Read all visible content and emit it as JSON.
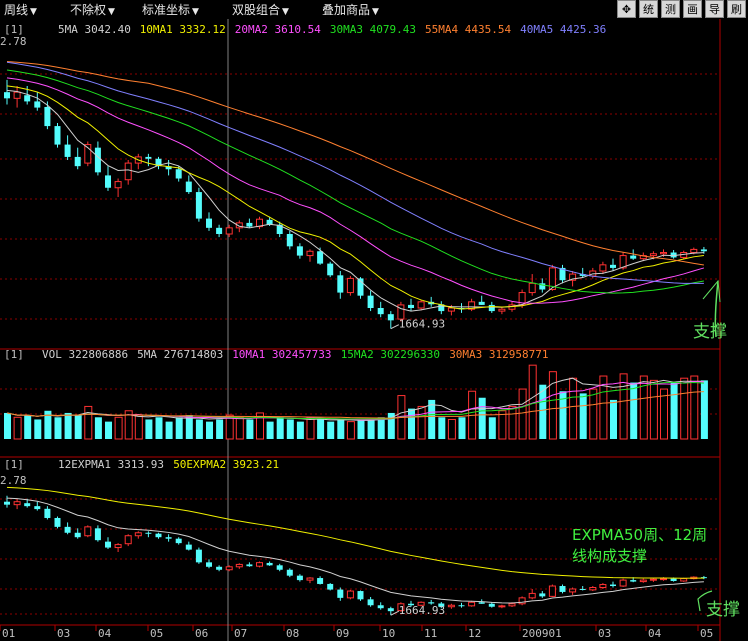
{
  "toolbar": {
    "menus": [
      {
        "label": "周线"
      },
      {
        "label": "不除权"
      },
      {
        "label": "标准坐标"
      },
      {
        "label": "双股组合"
      },
      {
        "label": "叠加商品"
      }
    ],
    "buttons": [
      {
        "icon": "move-crosshair-icon",
        "label": "✥"
      },
      {
        "icon": "",
        "label": "统"
      },
      {
        "icon": "",
        "label": "测"
      },
      {
        "icon": "",
        "label": "画"
      },
      {
        "icon": "",
        "label": "导"
      },
      {
        "icon": "",
        "label": "刷"
      }
    ]
  },
  "chart_data": [
    {
      "panel": "price",
      "type": "candlestick",
      "header_prefix": "[1]",
      "y_top_label": "2.78",
      "indicators": [
        {
          "name": "5MA",
          "value": "3042.40",
          "color": "#d0d0d0"
        },
        {
          "name": "10MA1",
          "value": "3332.12",
          "color": "#f0f000"
        },
        {
          "name": "20MA2",
          "value": "3610.54",
          "color": "#ff50ff"
        },
        {
          "name": "30MA3",
          "value": "4079.43",
          "color": "#20e020"
        },
        {
          "name": "55MA4",
          "value": "4435.54",
          "color": "#ff8030"
        },
        {
          "name": "40MA5",
          "value": "4425.36",
          "color": "#8080ff"
        }
      ],
      "low_label": "1664.93",
      "annotation": "支撑",
      "ylim": [
        1400,
        6200
      ],
      "ohlc": [
        [
          5500,
          5700,
          5300,
          5400
        ],
        [
          5400,
          5600,
          5250,
          5500
        ],
        [
          5450,
          5600,
          5300,
          5350
        ],
        [
          5350,
          5500,
          5200,
          5250
        ],
        [
          5260,
          5350,
          4900,
          4950
        ],
        [
          4950,
          5000,
          4600,
          4650
        ],
        [
          4650,
          4800,
          4400,
          4450
        ],
        [
          4450,
          4600,
          4250,
          4300
        ],
        [
          4350,
          4700,
          4300,
          4650
        ],
        [
          4600,
          4700,
          4150,
          4200
        ],
        [
          4150,
          4300,
          3900,
          3950
        ],
        [
          3950,
          4100,
          3800,
          4050
        ],
        [
          4080,
          4400,
          4000,
          4350
        ],
        [
          4350,
          4500,
          4250,
          4450
        ],
        [
          4450,
          4500,
          4300,
          4420
        ],
        [
          4420,
          4450,
          4250,
          4300
        ],
        [
          4300,
          4400,
          4150,
          4250
        ],
        [
          4250,
          4300,
          4050,
          4100
        ],
        [
          4050,
          4150,
          3850,
          3880
        ],
        [
          3880,
          3950,
          3400,
          3450
        ],
        [
          3450,
          3550,
          3250,
          3300
        ],
        [
          3300,
          3350,
          3150,
          3200
        ],
        [
          3200,
          3350,
          3150,
          3300
        ],
        [
          3300,
          3420,
          3230,
          3380
        ],
        [
          3380,
          3450,
          3300,
          3320
        ],
        [
          3320,
          3480,
          3280,
          3440
        ],
        [
          3430,
          3480,
          3330,
          3350
        ],
        [
          3350,
          3400,
          3150,
          3200
        ],
        [
          3200,
          3250,
          2950,
          3000
        ],
        [
          3000,
          3050,
          2800,
          2850
        ],
        [
          2850,
          2950,
          2750,
          2920
        ],
        [
          2920,
          2980,
          2700,
          2720
        ],
        [
          2720,
          2750,
          2500,
          2530
        ],
        [
          2530,
          2600,
          2150,
          2250
        ],
        [
          2250,
          2520,
          2200,
          2480
        ],
        [
          2480,
          2500,
          2150,
          2200
        ],
        [
          2200,
          2280,
          1950,
          2000
        ],
        [
          2000,
          2100,
          1850,
          1900
        ],
        [
          1900,
          1950,
          1664.93,
          1800
        ],
        [
          1820,
          2100,
          1780,
          2050
        ],
        [
          2050,
          2150,
          1950,
          2000
        ],
        [
          2000,
          2130,
          1960,
          2100
        ],
        [
          2100,
          2180,
          2020,
          2060
        ],
        [
          2060,
          2110,
          1900,
          1950
        ],
        [
          1950,
          2050,
          1880,
          2000
        ],
        [
          2000,
          2080,
          1920,
          1980
        ],
        [
          1980,
          2150,
          1950,
          2100
        ],
        [
          2100,
          2200,
          2050,
          2050
        ],
        [
          2050,
          2100,
          1920,
          1950
        ],
        [
          1950,
          2020,
          1900,
          1980
        ],
        [
          1980,
          2100,
          1940,
          2050
        ],
        [
          2050,
          2300,
          2000,
          2250
        ],
        [
          2250,
          2550,
          2200,
          2400
        ],
        [
          2400,
          2480,
          2250,
          2300
        ],
        [
          2300,
          2700,
          2280,
          2650
        ],
        [
          2650,
          2700,
          2400,
          2450
        ],
        [
          2450,
          2600,
          2350,
          2550
        ],
        [
          2550,
          2650,
          2500,
          2520
        ],
        [
          2520,
          2650,
          2480,
          2600
        ],
        [
          2600,
          2750,
          2550,
          2700
        ],
        [
          2700,
          2800,
          2600,
          2650
        ],
        [
          2650,
          2900,
          2620,
          2850
        ],
        [
          2850,
          2950,
          2780,
          2800
        ],
        [
          2800,
          2900,
          2760,
          2850
        ],
        [
          2850,
          2920,
          2790,
          2880
        ],
        [
          2880,
          2950,
          2830,
          2900
        ],
        [
          2900,
          2940,
          2800,
          2820
        ],
        [
          2820,
          2930,
          2790,
          2900
        ],
        [
          2900,
          2980,
          2870,
          2950
        ],
        [
          2950,
          2990,
          2880,
          2920
        ]
      ]
    },
    {
      "panel": "volume",
      "type": "bar",
      "header_prefix": "[1]",
      "indicators": [
        {
          "name": "VOL",
          "value": "322806886",
          "color": "#d0d0d0"
        },
        {
          "name": "5MA",
          "value": "276714803",
          "color": "#d0d0d0"
        },
        {
          "name": "10MA1",
          "value": "302457733",
          "color": "#ff50ff"
        },
        {
          "name": "15MA2",
          "value": "302296330",
          "color": "#20e020"
        },
        {
          "name": "30MA3",
          "value": "312958771",
          "color": "#ff8030"
        }
      ],
      "ylim": [
        0,
        3.5
      ],
      "volumes": [
        1.2,
        1.0,
        1.1,
        0.9,
        1.3,
        1.0,
        1.2,
        1.1,
        1.5,
        1.0,
        0.8,
        1.0,
        1.3,
        1.1,
        0.9,
        1.0,
        0.8,
        1.0,
        1.1,
        0.9,
        0.8,
        0.9,
        1.1,
        1.0,
        0.9,
        1.2,
        0.8,
        1.0,
        0.9,
        0.8,
        1.0,
        0.9,
        0.8,
        0.9,
        0.8,
        0.9,
        0.9,
        1.0,
        1.2,
        2.0,
        1.4,
        1.5,
        1.8,
        1.0,
        0.9,
        1.0,
        2.2,
        1.9,
        1.0,
        1.3,
        1.5,
        2.3,
        3.4,
        2.5,
        3.1,
        2.2,
        2.8,
        2.1,
        2.3,
        2.9,
        1.8,
        3.0,
        2.6,
        2.9,
        2.7,
        2.3,
        2.6,
        2.8,
        2.9,
        2.7
      ]
    },
    {
      "panel": "expma",
      "type": "candlestick",
      "header_prefix": "[1]",
      "y_top_label": "2.78",
      "indicators": [
        {
          "name": "12EXPMA1",
          "value": "3313.93",
          "color": "#d0d0d0"
        },
        {
          "name": "50EXPMA2",
          "value": "3923.21",
          "color": "#f0f000"
        }
      ],
      "low_label": "1664.93",
      "ylim": [
        1400,
        6200
      ],
      "annotation_main": [
        "EXPMA50周、12周",
        "线构成支撑"
      ],
      "annotation": "支撑",
      "x_tick_labels": [
        "01",
        "03",
        "04",
        "05",
        "06",
        "07",
        "08",
        "09",
        "10",
        "11",
        "12",
        "200901",
        "03",
        "04",
        "05"
      ]
    }
  ]
}
